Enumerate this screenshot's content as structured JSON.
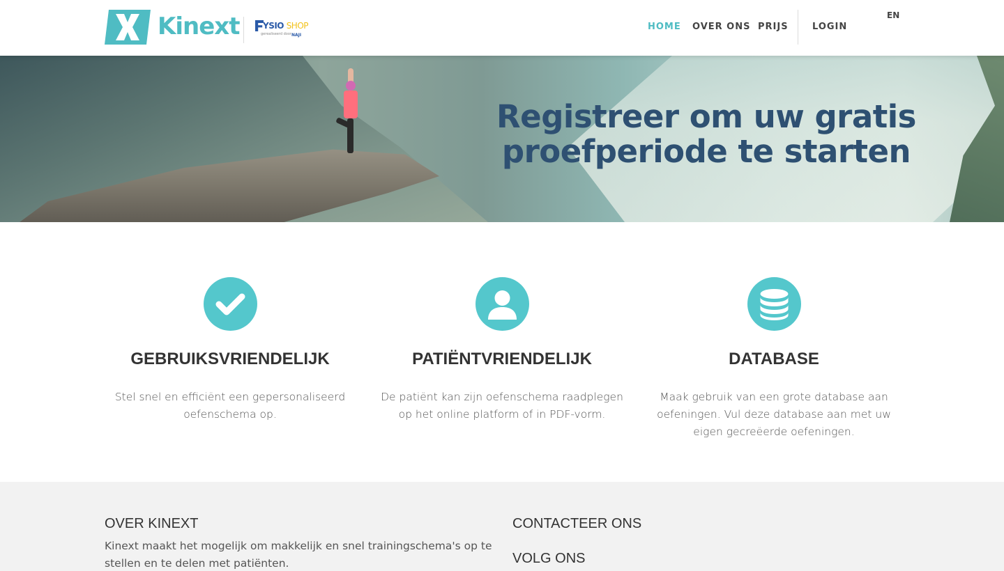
{
  "header": {
    "brand": "Kinext",
    "partner": {
      "name_part1": "YSIO",
      "name_part2": "SHOP",
      "sub": "gerealiseerd door",
      "sub2": "NAJI"
    },
    "nav": [
      {
        "label": "HOME",
        "active": true
      },
      {
        "label": "OVER ONS",
        "active": false
      },
      {
        "label": "PRIJS",
        "active": false
      }
    ],
    "login": "LOGIN",
    "language": "EN"
  },
  "hero": {
    "title_line1": "Registreer om uw gratis",
    "title_line2": "proefperiode te starten"
  },
  "features": [
    {
      "icon": "check-icon",
      "title": "GEBRUIKSVRIENDELIJK",
      "text": "Stel snel en efficiënt een gepersonaliseerd oefenschema op."
    },
    {
      "icon": "user-icon",
      "title": "PATIËNTVRIENDELIJK",
      "text": "De patiënt kan zijn oefenschema raadplegen op het online platform of in PDF-vorm."
    },
    {
      "icon": "database-icon",
      "title": "DATABASE",
      "text": "Maak gebruik van een grote database aan oefeningen. Vul deze database aan met uw eigen gecreëerde oefeningen."
    }
  ],
  "footer": {
    "about_title": "OVER KINEXT",
    "about_text": "Kinext maakt het mogelijk om makkelijk en snel trainingschema's op te stellen en te delen met patiënten.",
    "contact_title": "CONTACTEER ONS",
    "follow_title": "VOLG ONS"
  },
  "colors": {
    "accent": "#4fbcc3",
    "icon_bg": "#54c7cc",
    "hero_title": "#2e5072",
    "footer_bg": "#f2f2f2"
  }
}
